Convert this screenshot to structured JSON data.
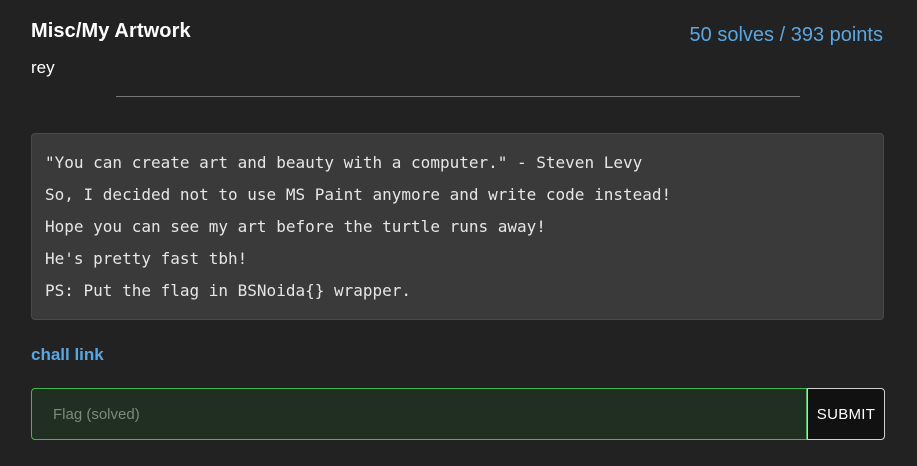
{
  "challenge": {
    "title": "Misc/My Artwork",
    "author": "rey",
    "stats": "50 solves / 393 points",
    "description_lines": [
      "\"You can create art and beauty with a computer.\" - Steven Levy",
      "So, I decided not to use MS Paint anymore and write code instead!",
      "Hope you can see my art before the turtle runs away!",
      "He's pretty fast tbh!",
      "PS: Put the flag in BSNoida{} wrapper."
    ],
    "link_label": "chall link"
  },
  "flag_form": {
    "placeholder": "Flag (solved)",
    "value": "",
    "submit_label": "SUBMIT"
  },
  "colors": {
    "background": "#222222",
    "accent": "#5aa6e0",
    "success_border": "#3fb950",
    "box": "#3a3a3a"
  }
}
